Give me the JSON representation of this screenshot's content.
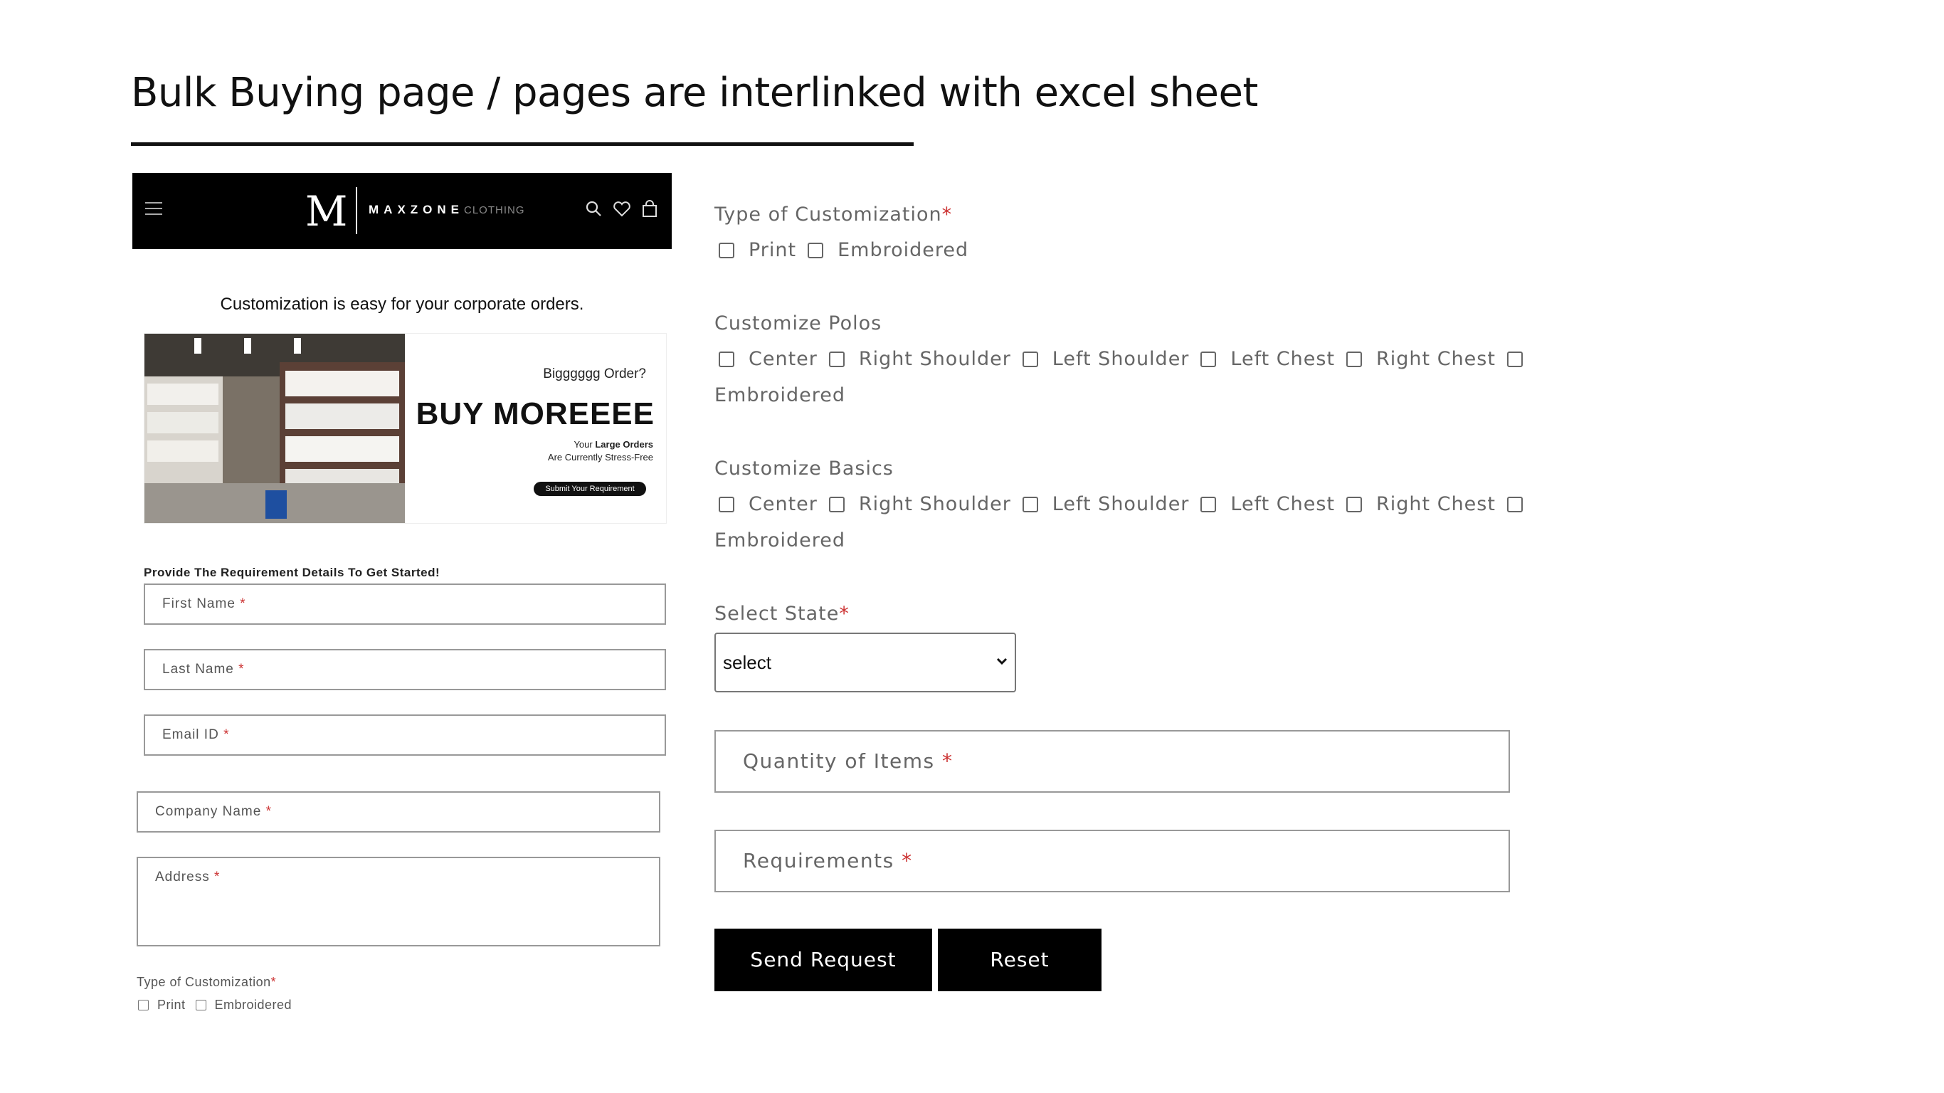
{
  "slide": {
    "title": "Bulk Buying page / pages are interlinked with excel sheet"
  },
  "mobile": {
    "header": {
      "logo_letter": "M",
      "logo_word": "MAXZONE",
      "logo_word_light": "CLOTHING",
      "icons": [
        "menu-icon",
        "search-icon",
        "heart-icon",
        "bag-icon"
      ]
    },
    "tagline": "Customization is easy for your corporate orders.",
    "banner": {
      "question": "Bigggggg Order?",
      "headline": "BUY MOREEEE",
      "line1_prefix": "Your ",
      "line1_bold": "Large Orders",
      "line2": "Are Currently Stress-Free",
      "button": "Submit Your Requirement"
    },
    "form": {
      "heading": "Provide The Requirement Details To Get Started!",
      "first_name": "First Name",
      "last_name": "Last Name",
      "email": "Email ID",
      "company": "Company Name",
      "address": "Address",
      "required_mark": "*",
      "customization_label": "Type of Customization",
      "customization_options": [
        "Print",
        "Embroidered"
      ]
    }
  },
  "desktop_form": {
    "required_mark": "*",
    "type_label": "Type of Customization",
    "type_options": [
      "Print",
      "Embroidered"
    ],
    "polos_label": "Customize Polos",
    "polos_options": [
      "Center",
      "Right Shoulder",
      "Left Shoulder",
      "Left Chest",
      "Right Chest",
      "Embroidered"
    ],
    "basics_label": "Customize Basics",
    "basics_options": [
      "Center",
      "Right Shoulder",
      "Left Shoulder",
      "Left Chest",
      "Right Chest",
      "Embroidered"
    ],
    "state_label": "Select State",
    "state_value": "select",
    "quantity_placeholder": "Quantity of Items",
    "requirements_placeholder": "Requirements",
    "send_button": "Send Request",
    "reset_button": "Reset"
  }
}
